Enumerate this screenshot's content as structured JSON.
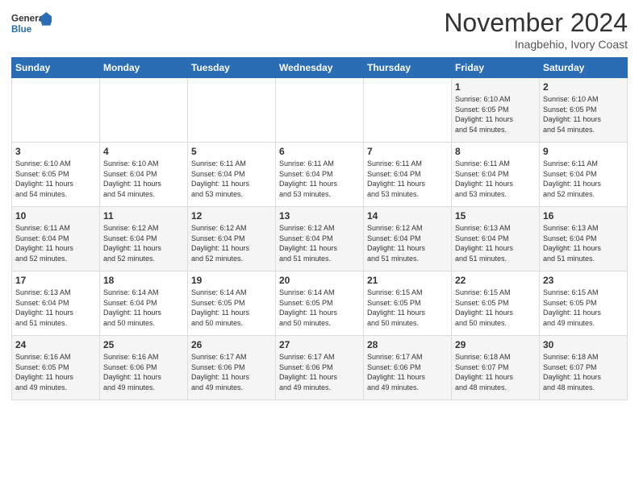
{
  "header": {
    "logo_line1": "General",
    "logo_line2": "Blue",
    "month": "November 2024",
    "location": "Inagbehio, Ivory Coast"
  },
  "days_of_week": [
    "Sunday",
    "Monday",
    "Tuesday",
    "Wednesday",
    "Thursday",
    "Friday",
    "Saturday"
  ],
  "weeks": [
    [
      {
        "day": "",
        "info": ""
      },
      {
        "day": "",
        "info": ""
      },
      {
        "day": "",
        "info": ""
      },
      {
        "day": "",
        "info": ""
      },
      {
        "day": "",
        "info": ""
      },
      {
        "day": "1",
        "info": "Sunrise: 6:10 AM\nSunset: 6:05 PM\nDaylight: 11 hours\nand 54 minutes."
      },
      {
        "day": "2",
        "info": "Sunrise: 6:10 AM\nSunset: 6:05 PM\nDaylight: 11 hours\nand 54 minutes."
      }
    ],
    [
      {
        "day": "3",
        "info": "Sunrise: 6:10 AM\nSunset: 6:05 PM\nDaylight: 11 hours\nand 54 minutes."
      },
      {
        "day": "4",
        "info": "Sunrise: 6:10 AM\nSunset: 6:04 PM\nDaylight: 11 hours\nand 54 minutes."
      },
      {
        "day": "5",
        "info": "Sunrise: 6:11 AM\nSunset: 6:04 PM\nDaylight: 11 hours\nand 53 minutes."
      },
      {
        "day": "6",
        "info": "Sunrise: 6:11 AM\nSunset: 6:04 PM\nDaylight: 11 hours\nand 53 minutes."
      },
      {
        "day": "7",
        "info": "Sunrise: 6:11 AM\nSunset: 6:04 PM\nDaylight: 11 hours\nand 53 minutes."
      },
      {
        "day": "8",
        "info": "Sunrise: 6:11 AM\nSunset: 6:04 PM\nDaylight: 11 hours\nand 53 minutes."
      },
      {
        "day": "9",
        "info": "Sunrise: 6:11 AM\nSunset: 6:04 PM\nDaylight: 11 hours\nand 52 minutes."
      }
    ],
    [
      {
        "day": "10",
        "info": "Sunrise: 6:11 AM\nSunset: 6:04 PM\nDaylight: 11 hours\nand 52 minutes."
      },
      {
        "day": "11",
        "info": "Sunrise: 6:12 AM\nSunset: 6:04 PM\nDaylight: 11 hours\nand 52 minutes."
      },
      {
        "day": "12",
        "info": "Sunrise: 6:12 AM\nSunset: 6:04 PM\nDaylight: 11 hours\nand 52 minutes."
      },
      {
        "day": "13",
        "info": "Sunrise: 6:12 AM\nSunset: 6:04 PM\nDaylight: 11 hours\nand 51 minutes."
      },
      {
        "day": "14",
        "info": "Sunrise: 6:12 AM\nSunset: 6:04 PM\nDaylight: 11 hours\nand 51 minutes."
      },
      {
        "day": "15",
        "info": "Sunrise: 6:13 AM\nSunset: 6:04 PM\nDaylight: 11 hours\nand 51 minutes."
      },
      {
        "day": "16",
        "info": "Sunrise: 6:13 AM\nSunset: 6:04 PM\nDaylight: 11 hours\nand 51 minutes."
      }
    ],
    [
      {
        "day": "17",
        "info": "Sunrise: 6:13 AM\nSunset: 6:04 PM\nDaylight: 11 hours\nand 51 minutes."
      },
      {
        "day": "18",
        "info": "Sunrise: 6:14 AM\nSunset: 6:04 PM\nDaylight: 11 hours\nand 50 minutes."
      },
      {
        "day": "19",
        "info": "Sunrise: 6:14 AM\nSunset: 6:05 PM\nDaylight: 11 hours\nand 50 minutes."
      },
      {
        "day": "20",
        "info": "Sunrise: 6:14 AM\nSunset: 6:05 PM\nDaylight: 11 hours\nand 50 minutes."
      },
      {
        "day": "21",
        "info": "Sunrise: 6:15 AM\nSunset: 6:05 PM\nDaylight: 11 hours\nand 50 minutes."
      },
      {
        "day": "22",
        "info": "Sunrise: 6:15 AM\nSunset: 6:05 PM\nDaylight: 11 hours\nand 50 minutes."
      },
      {
        "day": "23",
        "info": "Sunrise: 6:15 AM\nSunset: 6:05 PM\nDaylight: 11 hours\nand 49 minutes."
      }
    ],
    [
      {
        "day": "24",
        "info": "Sunrise: 6:16 AM\nSunset: 6:05 PM\nDaylight: 11 hours\nand 49 minutes."
      },
      {
        "day": "25",
        "info": "Sunrise: 6:16 AM\nSunset: 6:06 PM\nDaylight: 11 hours\nand 49 minutes."
      },
      {
        "day": "26",
        "info": "Sunrise: 6:17 AM\nSunset: 6:06 PM\nDaylight: 11 hours\nand 49 minutes."
      },
      {
        "day": "27",
        "info": "Sunrise: 6:17 AM\nSunset: 6:06 PM\nDaylight: 11 hours\nand 49 minutes."
      },
      {
        "day": "28",
        "info": "Sunrise: 6:17 AM\nSunset: 6:06 PM\nDaylight: 11 hours\nand 49 minutes."
      },
      {
        "day": "29",
        "info": "Sunrise: 6:18 AM\nSunset: 6:07 PM\nDaylight: 11 hours\nand 48 minutes."
      },
      {
        "day": "30",
        "info": "Sunrise: 6:18 AM\nSunset: 6:07 PM\nDaylight: 11 hours\nand 48 minutes."
      }
    ]
  ]
}
